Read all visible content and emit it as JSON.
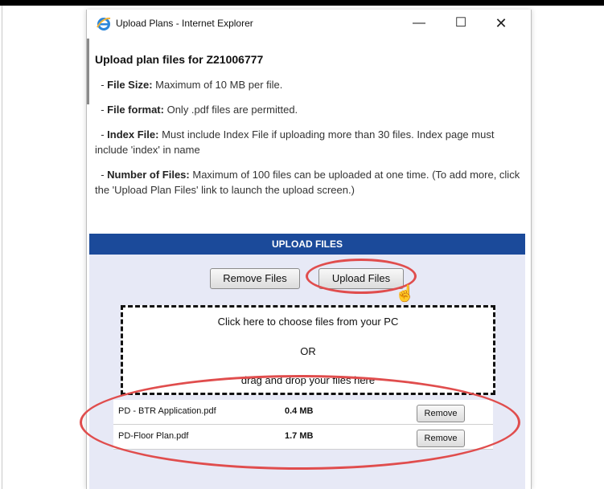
{
  "window": {
    "title": "Upload Plans - Internet Explorer",
    "controls": {
      "minimize": "—",
      "maximize": "☐",
      "close": "✕"
    }
  },
  "page": {
    "heading": "Upload plan files for Z21006777",
    "rules": [
      {
        "label": "File Size:",
        "text": "Maximum of 10 MB per file."
      },
      {
        "label": "File format:",
        "text": "Only .pdf files are permitted."
      },
      {
        "label": "Index File:",
        "text": "Must include Index File if uploading more than 30 files. Index page must include 'index' in name"
      },
      {
        "label": "Number of Files:",
        "text": "Maximum of 100 files can be uploaded at one time. (To add more, click the 'Upload Plan Files' link to launch the upload screen.)"
      }
    ]
  },
  "upload": {
    "header": "UPLOAD FILES",
    "remove_files_label": "Remove Files",
    "upload_files_label": "Upload Files",
    "dropzone": {
      "line1": "Click here to choose files from your PC",
      "or": "OR",
      "line2": "drag and drop your files here"
    },
    "files": [
      {
        "name": "PD - BTR Application.pdf",
        "size": "0.4 MB",
        "remove_label": "Remove"
      },
      {
        "name": "PD-Floor Plan.pdf",
        "size": "1.7 MB",
        "remove_label": "Remove"
      }
    ]
  },
  "colors": {
    "header_bg": "#1b4a9a",
    "panel_bg": "#e7e9f6",
    "highlight": "#e04d4d"
  },
  "icons": [
    "internet-explorer-icon",
    "hand-cursor-icon"
  ]
}
